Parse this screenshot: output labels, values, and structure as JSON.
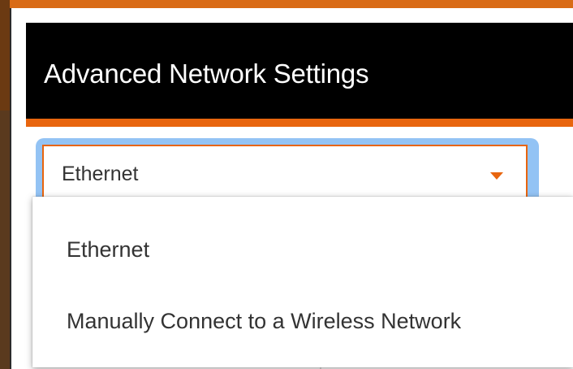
{
  "dialog": {
    "title": "Advanced Network Settings"
  },
  "connection_select": {
    "selected_value": "Ethernet",
    "caret_icon": "caret-down-icon",
    "options": [
      {
        "label": "Ethernet"
      },
      {
        "label": "Manually Connect to a Wireless Network"
      }
    ]
  },
  "colors": {
    "accent": "#e8650e",
    "header_bg": "#000000",
    "focus_ring": "#93c3f4",
    "radio_selected": "#2f7ed8"
  }
}
